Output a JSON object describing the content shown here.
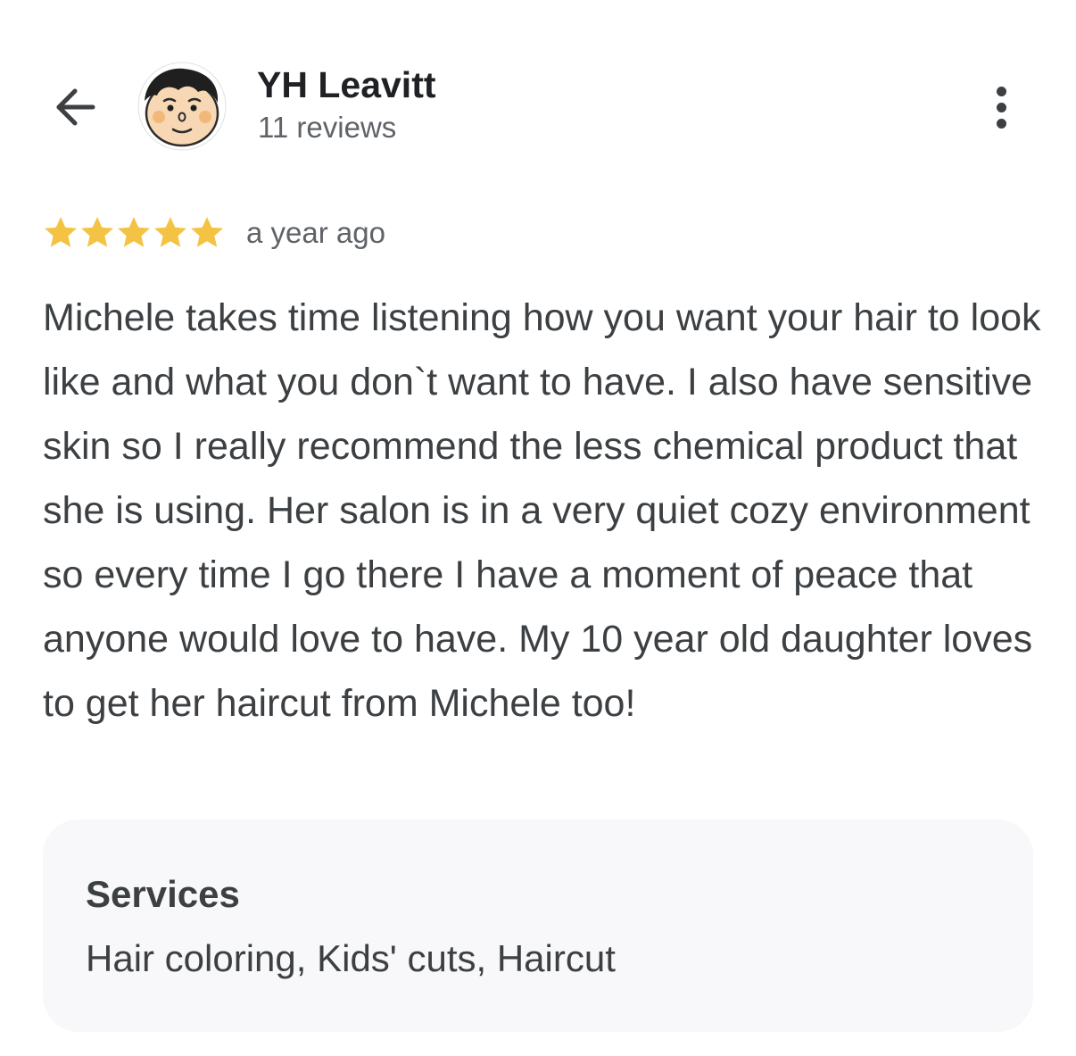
{
  "header": {
    "back_icon": "arrow-left-icon",
    "user_name": "YH Leavitt",
    "review_count": "11 reviews",
    "more_icon": "more-vertical-icon"
  },
  "review": {
    "rating": 5,
    "rating_max": 5,
    "star_color": "#f4c343",
    "date": "a year ago",
    "text": "Michele takes time listening how you want your hair to look like and what you don`t want to have. I also have sensitive skin so I really recommend the less chemical product that she is using. Her salon is in a very quiet cozy environment so every time I go there I have a moment of peace that anyone would love to have. My 10 year old daughter loves to get her haircut from Michele too!"
  },
  "services": {
    "title": "Services",
    "list": "Hair coloring, Kids' cuts, Haircut"
  }
}
